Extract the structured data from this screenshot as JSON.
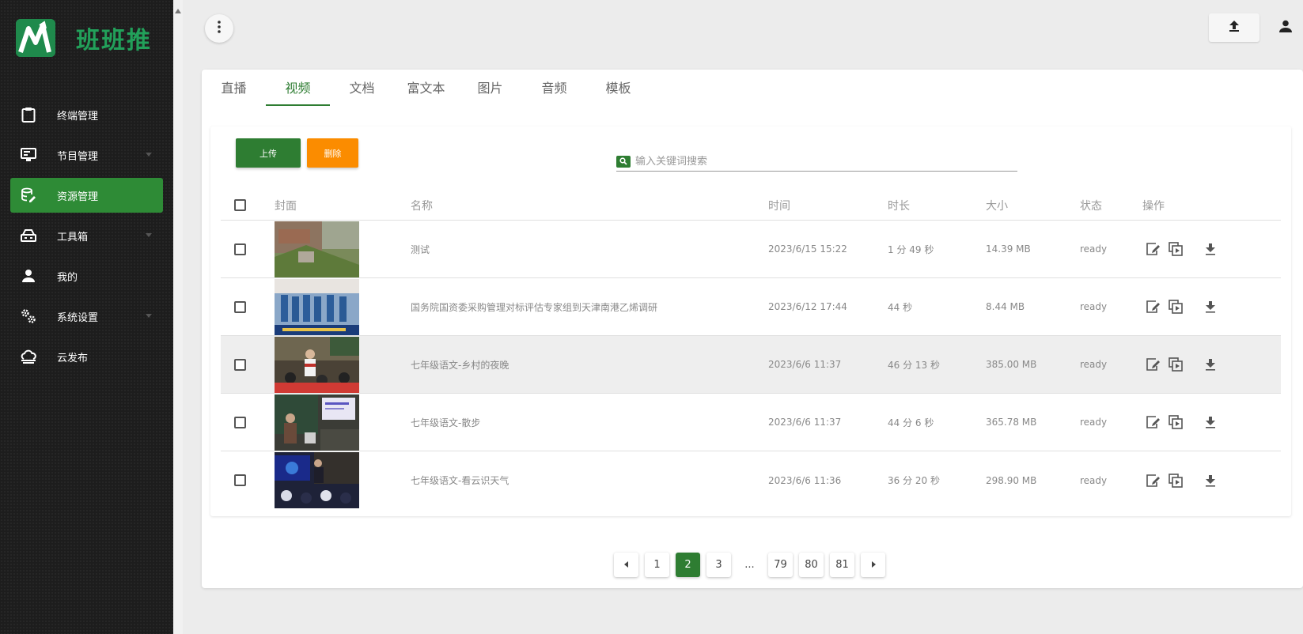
{
  "app": {
    "name": "班班推"
  },
  "sidebar": {
    "items": [
      {
        "label": "终端管理",
        "icon": "clipboard-icon",
        "has_arrow": false
      },
      {
        "label": "节目管理",
        "icon": "monitor-icon",
        "has_arrow": true
      },
      {
        "label": "资源管理",
        "icon": "database-edit-icon",
        "has_arrow": false,
        "active": true
      },
      {
        "label": "工具箱",
        "icon": "toolbox-icon",
        "has_arrow": true
      },
      {
        "label": "我的",
        "icon": "person-icon",
        "has_arrow": false
      },
      {
        "label": "系统设置",
        "icon": "gears-icon",
        "has_arrow": true
      },
      {
        "label": "云发布",
        "icon": "cloud-upload-icon",
        "has_arrow": false
      }
    ]
  },
  "tabs": [
    {
      "label": "直播"
    },
    {
      "label": "视频",
      "active": true
    },
    {
      "label": "文档"
    },
    {
      "label": "富文本"
    },
    {
      "label": "图片"
    },
    {
      "label": "音频"
    },
    {
      "label": "模板"
    }
  ],
  "toolbar": {
    "upload_label": "上传",
    "delete_label": "删除"
  },
  "search": {
    "placeholder": "输入关键词搜索",
    "value": ""
  },
  "table": {
    "headers": {
      "cover": "封面",
      "name": "名称",
      "time": "时间",
      "duration": "时长",
      "size": "大小",
      "status": "状态",
      "ops": "操作"
    },
    "rows": [
      {
        "name": "测试",
        "time": "2023/6/15 15:22",
        "duration": "1 分 49 秒",
        "size": "14.39 MB",
        "status": "ready"
      },
      {
        "name": "国务院国资委采购管理对标评估专家组到天津南港乙烯调研",
        "time": "2023/6/12 17:44",
        "duration": "44 秒",
        "size": "8.44 MB",
        "status": "ready"
      },
      {
        "name": "七年级语文-乡村的夜晚",
        "time": "2023/6/6 11:37",
        "duration": "46 分 13 秒",
        "size": "385.00 MB",
        "status": "ready",
        "highlight": true
      },
      {
        "name": "七年级语文-散步",
        "time": "2023/6/6 11:37",
        "duration": "44 分 6 秒",
        "size": "365.78 MB",
        "status": "ready"
      },
      {
        "name": "七年级语文-看云识天气",
        "time": "2023/6/6 11:36",
        "duration": "36 分 20 秒",
        "size": "298.90 MB",
        "status": "ready"
      }
    ]
  },
  "pagination": {
    "pages": [
      "1",
      "2",
      "3",
      "...",
      "79",
      "80",
      "81"
    ],
    "current": "2"
  },
  "colors": {
    "primary": "#2e7d32",
    "warning": "#fb8c00",
    "sidebar_bg": "#1d1d1d",
    "active_nav": "#2e8b36"
  }
}
